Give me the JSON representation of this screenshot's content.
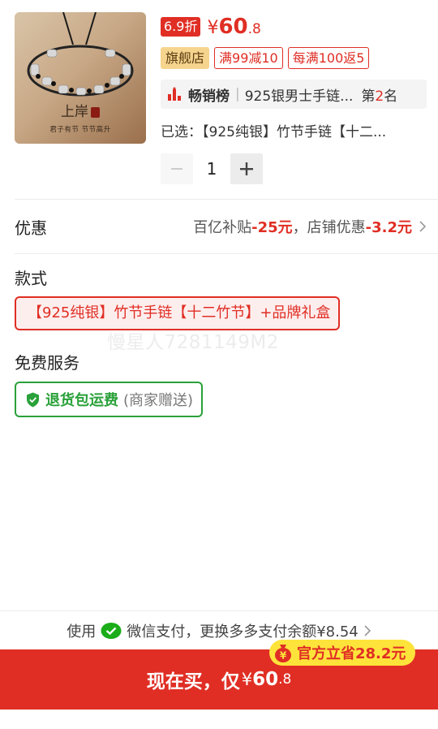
{
  "product": {
    "image_brand": "上岸",
    "image_slogan": "君子有节 节节高升",
    "discount_tag": "6.9折",
    "price_yen": "¥",
    "price_int": "60",
    "price_dec": ".8",
    "tags": {
      "flagship": "旗舰店",
      "coupon1": "满99减10",
      "coupon2": "每满100返5"
    },
    "rank": {
      "title": "畅销榜",
      "sep": "|",
      "name": "925银男士手链...",
      "pos_prefix": "第",
      "pos_num": "2",
      "pos_suffix": "名"
    },
    "selected": "已选：【925纯银】竹节手链【十二..."
  },
  "stepper": {
    "quantity": "1"
  },
  "discount_row": {
    "label": "优惠",
    "subsidy_text": "百亿补贴",
    "subsidy_val": "-25元",
    "comma": "，",
    "store_text": "店铺优惠",
    "store_val": "-3.2元"
  },
  "style_section": {
    "title": "款式",
    "option": "【925纯银】竹节手链【十二竹节】+品牌礼盒"
  },
  "watermark": "慢星人7281149M2",
  "service_section": {
    "title": "免费服务",
    "main": "退货包运费",
    "sub": "(商家赠送)"
  },
  "payment": {
    "use": "使用",
    "method": "微信支付，更换多多支付余额¥8.54"
  },
  "save_badge": {
    "text": "官方立省28.2元"
  },
  "buy_button": {
    "label": "现在买，仅",
    "yen": "¥",
    "int": "60",
    "dec": ".8"
  },
  "colors": {
    "accent_red": "#e02e24",
    "flagship_gold": "#f5d48e",
    "service_green": "#2aa13a",
    "badge_yellow": "#fee33b"
  }
}
